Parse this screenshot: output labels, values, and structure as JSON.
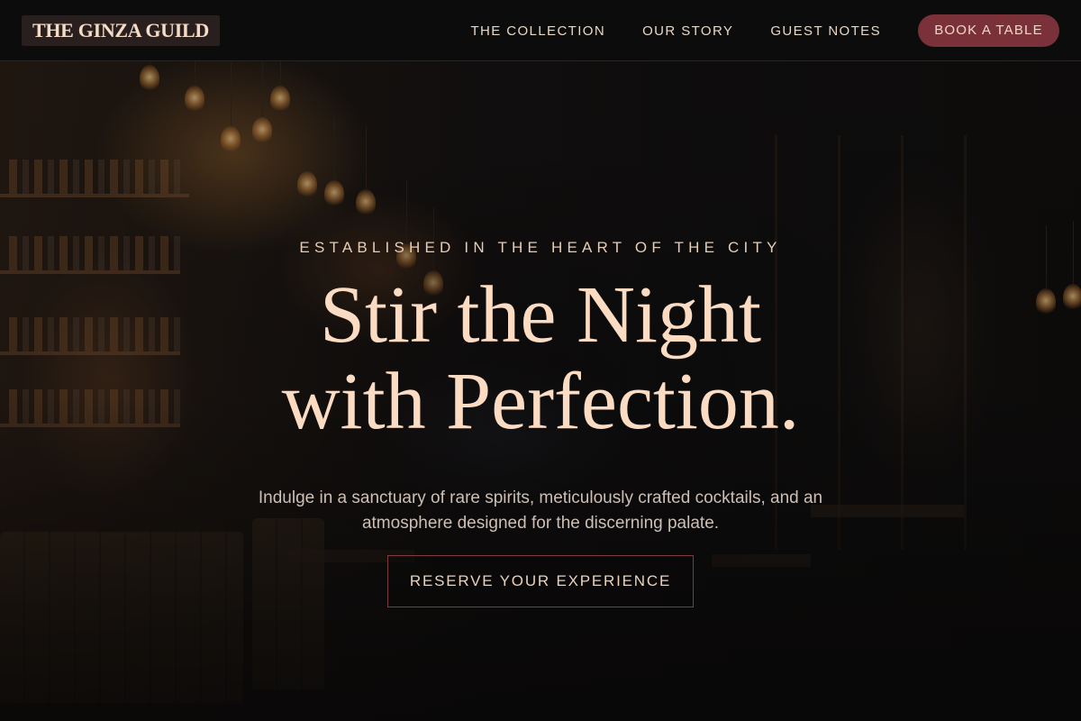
{
  "brand": {
    "name": "THE GINZA GUILD"
  },
  "nav": {
    "links": [
      {
        "label": "THE COLLECTION"
      },
      {
        "label": "OUR STORY"
      },
      {
        "label": "GUEST NOTES"
      }
    ],
    "cta_label": "BOOK A TABLE"
  },
  "hero": {
    "eyebrow": "ESTABLISHED IN THE HEART OF THE CITY",
    "headline_line1": "Stir the Night",
    "headline_line2": "with Perfection.",
    "subtext": "Indulge in a sanctuary of rare spirits, meticulously crafted cocktails, and an atmosphere designed for the discerning palate.",
    "cta_label": "RESERVE YOUR EXPERIENCE",
    "background_image": "dimly lit bar interior with hanging filament bulbs, liquor shelves and booth seating"
  },
  "colors": {
    "background": "#0c0b0b",
    "accent": "#7a313a",
    "headline": "#fbdcc3",
    "text": "#e9d6c3"
  }
}
